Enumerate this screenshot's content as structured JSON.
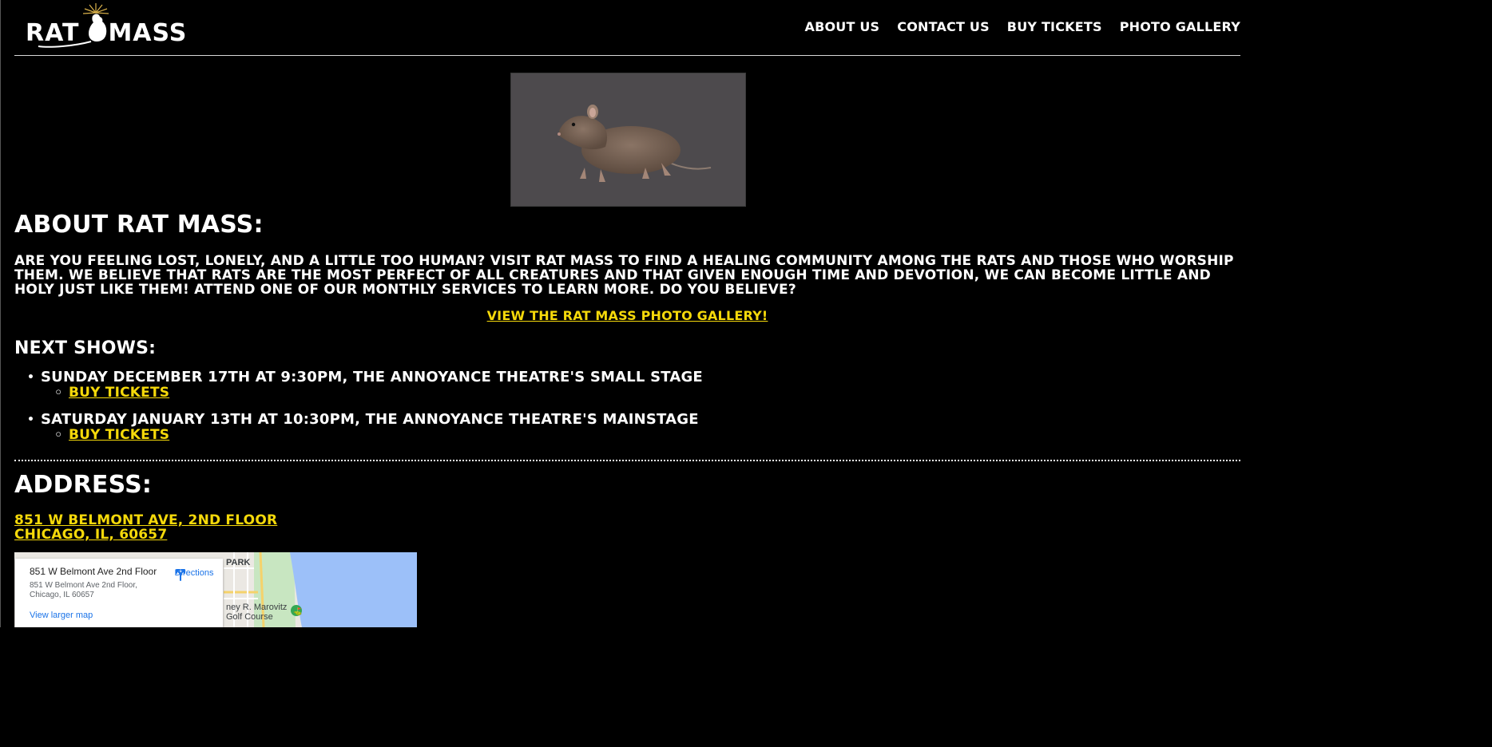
{
  "header": {
    "logo_left": "RAT",
    "logo_right": "MASS",
    "nav": [
      {
        "label": "About Us"
      },
      {
        "label": "Contact Us"
      },
      {
        "label": "Buy Tickets"
      },
      {
        "label": "Photo Gallery"
      }
    ]
  },
  "hero": {
    "image": "rat-photo"
  },
  "about": {
    "title": "About Rat Mass:",
    "text": "Are you feeling lost, lonely, and a little too human? Visit Rat Mass to find a healing community among the rats and those who worship them. We believe that rats are the most perfect of all creatures and that given enough time and devotion, we can become little and holy just like them! Attend one of our monthly services to learn more. Do you believe?",
    "gallery_link": "View the Rat Mass Photo Gallery!"
  },
  "shows": {
    "title": "Next Shows:",
    "items": [
      {
        "text": "Sunday December 17th at 9:30pm, The Annoyance Theatre's Small Stage",
        "link": "Buy Tickets"
      },
      {
        "text": "Saturday January 13th at 10:30pm, The Annoyance Theatre's Mainstage",
        "link": "Buy Tickets"
      }
    ]
  },
  "address": {
    "title": "Address:",
    "line1": "851 W Belmont Ave, 2nd Floor",
    "line2": "Chicago, IL, 60657"
  },
  "map": {
    "place_name": "851 W Belmont Ave 2nd Floor",
    "address": "851 W Belmont Ave 2nd Floor, Chicago, IL 60657",
    "directions": "Directions",
    "larger_map": "View larger map",
    "label_park": "PARK",
    "label_golf": "ney R. Marovitz\nGolf Course",
    "colors": {
      "water": "#9cc0f9",
      "park": "#c8e6c1",
      "road": "#f5d26b"
    }
  },
  "colors": {
    "background": "#000000",
    "text": "#ffffff",
    "link": "#f5d90a",
    "hero_bg": "#4d4a4d"
  }
}
